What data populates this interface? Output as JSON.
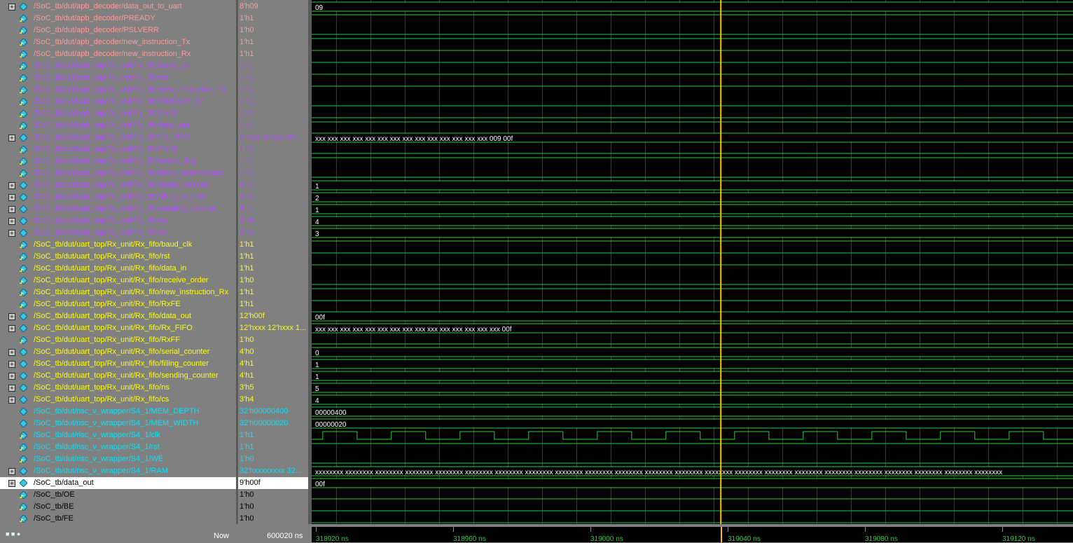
{
  "signals": [
    {
      "name": "/SoC_tb/dut/apb_decoder/data_out_to_uart",
      "value": "8'h09",
      "color": "#ff9a9a",
      "expand": true,
      "wave": "bus",
      "text": "09"
    },
    {
      "name": "/SoC_tb/dut/apb_decoder/PREADY",
      "value": "1'h1",
      "color": "#ff9a9a",
      "expand": false,
      "wave": "high"
    },
    {
      "name": "/SoC_tb/dut/apb_decoder/PSLVERR",
      "value": "1'h0",
      "color": "#ff9a9a",
      "expand": false,
      "wave": "low"
    },
    {
      "name": "/SoC_tb/dut/apb_decoder/new_instruction_Tx",
      "value": "1'h1",
      "color": "#ff9a9a",
      "expand": false,
      "wave": "high"
    },
    {
      "name": "/SoC_tb/dut/apb_decoder/new_instruction_Rx",
      "value": "1'h1",
      "color": "#ff9a9a",
      "expand": false,
      "wave": "high"
    },
    {
      "name": "/SoC_tb/dut/uart_top/Tx_unit/Tx_fifo/baud_clk",
      "value": "1'h1",
      "color": "#b04aff",
      "expand": false,
      "wave": "high"
    },
    {
      "name": "/SoC_tb/dut/uart_top/Tx_unit/Tx_fifo/rst",
      "value": "1'h1",
      "color": "#b04aff",
      "expand": false,
      "wave": "high"
    },
    {
      "name": "/SoC_tb/dut/uart_top/Tx_unit/Tx_fifo/new_instruction_Tx",
      "value": "1'h1",
      "color": "#b04aff",
      "expand": false,
      "wave": "high"
    },
    {
      "name": "/SoC_tb/dut/uart_top/Tx_unit/Tx_fifo/PREADY_W",
      "value": "1'h0",
      "color": "#b04aff",
      "expand": false,
      "wave": "low"
    },
    {
      "name": "/SoC_tb/dut/uart_top/Tx_unit/Tx_fifo/TxFF",
      "value": "1'h0",
      "color": "#b04aff",
      "expand": false,
      "wave": "low"
    },
    {
      "name": "/SoC_tb/dut/uart_top/Tx_unit/Tx_fifo/data_out",
      "value": "1'h1",
      "color": "#b04aff",
      "expand": false,
      "wave": "high"
    },
    {
      "name": "/SoC_tb/dut/uart_top/Tx_unit/Tx_fifo/Tx_FIFO",
      "value": "9'hxxx 9'hxxx 9'h...",
      "color": "#b04aff",
      "expand": true,
      "wave": "bus",
      "text": "xxx xxx xxx xxx xxx xxx xxx xxx xxx xxx xxx xxx xxx xxx 009 00f"
    },
    {
      "name": "/SoC_tb/dut/uart_top/Tx_unit/Tx_fifo/TxFE",
      "value": "1'h0",
      "color": "#b04aff",
      "expand": false,
      "wave": "low"
    },
    {
      "name": "/SoC_tb/dut/uart_top/Tx_unit/Tx_fifo/active_flag",
      "value": "1'h1",
      "color": "#b04aff",
      "expand": false,
      "wave": "high"
    },
    {
      "name": "/SoC_tb/dut/uart_top/Tx_unit/Tx_fifo/done_transmission",
      "value": "1'h0",
      "color": "#b04aff",
      "expand": false,
      "wave": "low"
    },
    {
      "name": "/SoC_tb/dut/uart_top/Tx_unit/Tx_fifo/serial_counter",
      "value": "4'h1",
      "color": "#b04aff",
      "expand": true,
      "wave": "bus",
      "text": "1"
    },
    {
      "name": "/SoC_tb/dut/uart_top/Tx_unit/Tx_fifo/filling_counter",
      "value": "4'h2",
      "color": "#b04aff",
      "expand": true,
      "wave": "bus",
      "text": "2"
    },
    {
      "name": "/SoC_tb/dut/uart_top/Tx_unit/Tx_fifo/sending_counter",
      "value": "4'h1",
      "color": "#b04aff",
      "expand": true,
      "wave": "bus",
      "text": "1"
    },
    {
      "name": "/SoC_tb/dut/uart_top/Tx_unit/Tx_fifo/ns",
      "value": "3'h4",
      "color": "#b04aff",
      "expand": true,
      "wave": "bus",
      "text": "4"
    },
    {
      "name": "/SoC_tb/dut/uart_top/Tx_unit/Tx_fifo/cs",
      "value": "3'h3",
      "color": "#b04aff",
      "expand": true,
      "wave": "bus",
      "text": "3"
    },
    {
      "name": "/SoC_tb/dut/uart_top/Rx_unit/Rx_fifo/baud_clk",
      "value": "1'h1",
      "color": "#ffff00",
      "expand": false,
      "wave": "high"
    },
    {
      "name": "/SoC_tb/dut/uart_top/Rx_unit/Rx_fifo/rst",
      "value": "1'h1",
      "color": "#ffff00",
      "expand": false,
      "wave": "high"
    },
    {
      "name": "/SoC_tb/dut/uart_top/Rx_unit/Rx_fifo/data_in",
      "value": "1'h1",
      "color": "#ffff00",
      "expand": false,
      "wave": "high"
    },
    {
      "name": "/SoC_tb/dut/uart_top/Rx_unit/Rx_fifo/receive_order",
      "value": "1'h0",
      "color": "#ffff00",
      "expand": false,
      "wave": "low"
    },
    {
      "name": "/SoC_tb/dut/uart_top/Rx_unit/Rx_fifo/new_instruction_Rx",
      "value": "1'h1",
      "color": "#ffff00",
      "expand": false,
      "wave": "high"
    },
    {
      "name": "/SoC_tb/dut/uart_top/Rx_unit/Rx_fifo/RxFE",
      "value": "1'h1",
      "color": "#ffff00",
      "expand": false,
      "wave": "high"
    },
    {
      "name": "/SoC_tb/dut/uart_top/Rx_unit/Rx_fifo/data_out",
      "value": "12'h00f",
      "color": "#ffff00",
      "expand": true,
      "wave": "bus",
      "text": "00f"
    },
    {
      "name": "/SoC_tb/dut/uart_top/Rx_unit/Rx_fifo/Rx_FIFO",
      "value": "12'hxxx 12'hxxx 1...",
      "color": "#ffff00",
      "expand": true,
      "wave": "bus",
      "text": "xxx xxx xxx xxx xxx xxx xxx xxx xxx xxx xxx xxx xxx xxx xxx 00f"
    },
    {
      "name": "/SoC_tb/dut/uart_top/Rx_unit/Rx_fifo/RxFF",
      "value": "1'h0",
      "color": "#ffff00",
      "expand": false,
      "wave": "low"
    },
    {
      "name": "/SoC_tb/dut/uart_top/Rx_unit/Rx_fifo/serial_counter",
      "value": "4'h0",
      "color": "#ffff00",
      "expand": true,
      "wave": "bus",
      "text": "0"
    },
    {
      "name": "/SoC_tb/dut/uart_top/Rx_unit/Rx_fifo/filling_counter",
      "value": "4'h1",
      "color": "#ffff00",
      "expand": true,
      "wave": "bus",
      "text": "1"
    },
    {
      "name": "/SoC_tb/dut/uart_top/Rx_unit/Rx_fifo/sending_counter",
      "value": "4'h1",
      "color": "#ffff00",
      "expand": true,
      "wave": "bus",
      "text": "1"
    },
    {
      "name": "/SoC_tb/dut/uart_top/Rx_unit/Rx_fifo/ns",
      "value": "3'h5",
      "color": "#ffff00",
      "expand": true,
      "wave": "bus",
      "text": "5"
    },
    {
      "name": "/SoC_tb/dut/uart_top/Rx_unit/Rx_fifo/cs",
      "value": "3'h4",
      "color": "#ffff00",
      "expand": true,
      "wave": "bus",
      "text": "4"
    },
    {
      "name": "/SoC_tb/dut/risc_v_wrapper/S4_1/MEM_DEPTH",
      "value": "32'h00000400",
      "color": "#00e5ff",
      "expand": false,
      "wave": "bus",
      "text": "00000400"
    },
    {
      "name": "/SoC_tb/dut/risc_v_wrapper/S4_1/MEM_WIDTH",
      "value": "32'h00000020",
      "color": "#00e5ff",
      "expand": false,
      "wave": "bus",
      "text": "00000020"
    },
    {
      "name": "/SoC_tb/dut/risc_v_wrapper/S4_1/clk",
      "value": "1'h1",
      "color": "#00e5ff",
      "expand": false,
      "wave": "clock"
    },
    {
      "name": "/SoC_tb/dut/risc_v_wrapper/S4_1/rst",
      "value": "1'h1",
      "color": "#00e5ff",
      "expand": false,
      "wave": "high"
    },
    {
      "name": "/SoC_tb/dut/risc_v_wrapper/S4_1/WE",
      "value": "1'h0",
      "color": "#00e5ff",
      "expand": false,
      "wave": "low"
    },
    {
      "name": "/SoC_tb/dut/risc_v_wrapper/S4_1/RAM",
      "value": "32'hxxxxxxxx 32...",
      "color": "#00e5ff",
      "expand": true,
      "wave": "bus",
      "text": "xxxxxxxx xxxxxxxx xxxxxxxx xxxxxxxx xxxxxxxx xxxxxxxx xxxxxxxx xxxxxxxx xxxxxxxx xxxxxxxx xxxxxxxx xxxxxxxx xxxxxxxx xxxxxxxx xxxxxxxx xxxxxxxx xxxxxxxx xxxxxxxx xxxxxxxx xxxxxxxx xxxxxxxx xxxxxxxx xxxxxxxx"
    },
    {
      "name": "/SoC_tb/data_out",
      "value": "9'h00f",
      "color": "#000000",
      "expand": true,
      "wave": "bus",
      "text": "00f",
      "selected": true
    },
    {
      "name": "/SoC_tb/OE",
      "value": "1'h0",
      "color": "#000000",
      "expand": false,
      "wave": "low"
    },
    {
      "name": "/SoC_tb/BE",
      "value": "1'h0",
      "color": "#000000",
      "expand": false,
      "wave": "low"
    },
    {
      "name": "/SoC_tb/FE",
      "value": "1'h0",
      "color": "#000000",
      "expand": false,
      "wave": "low"
    }
  ],
  "status": {
    "now_label": "Now",
    "now_value": "600020 ns"
  },
  "timeline": {
    "ticks": [
      {
        "label": "318920 ns",
        "t": 318920
      },
      {
        "label": "318960 ns",
        "t": 318960
      },
      {
        "label": "319000 ns",
        "t": 319000
      },
      {
        "label": "319040 ns",
        "t": 319040
      },
      {
        "label": "319080 ns",
        "t": 319080
      },
      {
        "label": "319120 ns",
        "t": 319120
      }
    ],
    "cursor_t": 319038
  },
  "colors": {
    "wave_green": "#2ecc40",
    "cursor": "#ffc000",
    "bus_text": "#ffffff"
  }
}
